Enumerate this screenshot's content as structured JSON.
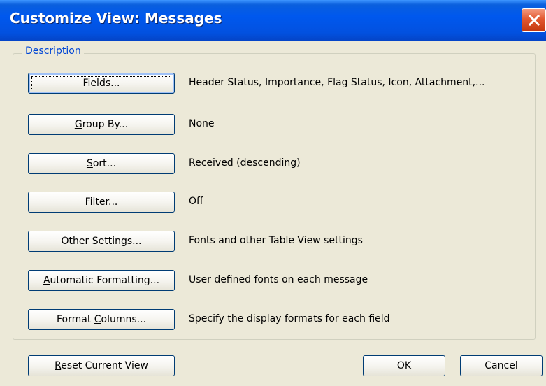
{
  "window": {
    "title": "Customize View: Messages"
  },
  "group": {
    "label": "Description"
  },
  "rows": [
    {
      "pre": "",
      "u": "F",
      "post": "ields...",
      "desc": "Header Status, Importance, Flag Status, Icon, Attachment,..."
    },
    {
      "pre": "",
      "u": "G",
      "post": "roup By...",
      "desc": "None"
    },
    {
      "pre": "",
      "u": "S",
      "post": "ort...",
      "desc": "Received (descending)"
    },
    {
      "pre": "Fi",
      "u": "l",
      "post": "ter...",
      "desc": "Off"
    },
    {
      "pre": "",
      "u": "O",
      "post": "ther Settings...",
      "desc": "Fonts and other Table View settings"
    },
    {
      "pre": "",
      "u": "A",
      "post": "utomatic Formatting...",
      "desc": "User defined fonts on each message"
    },
    {
      "pre": "Format ",
      "u": "C",
      "post": "olumns...",
      "desc": "Specify the display formats for each field"
    }
  ],
  "footer": {
    "reset": {
      "pre": "",
      "u": "R",
      "post": "eset Current View"
    },
    "ok": "OK",
    "cancel": "Cancel"
  }
}
